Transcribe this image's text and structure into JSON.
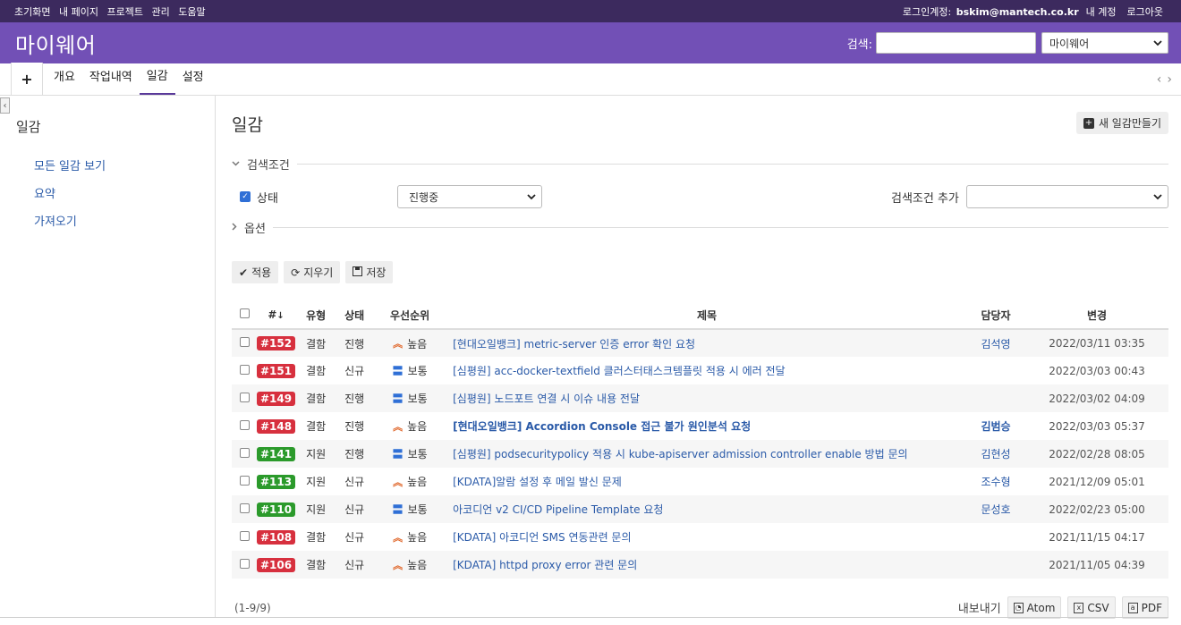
{
  "topbar": {
    "links": [
      "초기화면",
      "내 페이지",
      "프로젝트",
      "관리",
      "도움말"
    ],
    "login_label": "로그인계정:",
    "user": "bskim@mantech.co.kr",
    "my_account": "내 계정",
    "logout": "로그아웃"
  },
  "header": {
    "title": "마이웨어",
    "search_label": "검색:",
    "search_value": "",
    "project_select": "마이웨어"
  },
  "tabs": {
    "plus": "+",
    "items": [
      "개요",
      "작업내역",
      "일감",
      "설정"
    ],
    "active": "일감"
  },
  "sidebar": {
    "title": "일감",
    "links": [
      "모든 일감 보기",
      "요약",
      "가져오기"
    ]
  },
  "main": {
    "title": "일감",
    "new_button": "새 일감만들기",
    "filters_legend": "검색조건",
    "status_label": "상태",
    "status_value": "진행중",
    "add_filter_label": "검색조건 추가",
    "options_legend": "옵션",
    "apply": "적용",
    "clear": "지우기",
    "save": "저장"
  },
  "table": {
    "headers": {
      "id": "#",
      "tracker": "유형",
      "status": "상태",
      "priority": "우선순위",
      "subject": "제목",
      "assignee": "담당자",
      "updated": "변경"
    },
    "rows": [
      {
        "id": "#152",
        "kind": "bug",
        "tracker": "결함",
        "status": "진행",
        "priority": "높음",
        "pri": "hi",
        "subject": "[현대오일뱅크] metric-server 인증 error 확인 요청",
        "bold": false,
        "assignee": "김석영",
        "updated": "2022/03/11 03:35"
      },
      {
        "id": "#151",
        "kind": "bug",
        "tracker": "결함",
        "status": "신규",
        "priority": "보통",
        "pri": "no",
        "subject": "[심평원] acc-docker-textfield 클러스터태스크템플릿 적용 시 에러 전달",
        "bold": false,
        "assignee": "",
        "updated": "2022/03/03 00:43"
      },
      {
        "id": "#149",
        "kind": "bug",
        "tracker": "결함",
        "status": "진행",
        "priority": "보통",
        "pri": "no",
        "subject": "[심평원] 노드포트 연결 시 이슈 내용 전달",
        "bold": false,
        "assignee": "",
        "updated": "2022/03/02 04:09"
      },
      {
        "id": "#148",
        "kind": "bug",
        "tracker": "결함",
        "status": "진행",
        "priority": "높음",
        "pri": "hi",
        "subject": "[현대오일뱅크] Accordion Console 접근 불가 원인분석 요청",
        "bold": true,
        "assignee": "김범승",
        "updated": "2022/03/03 05:37"
      },
      {
        "id": "#141",
        "kind": "sup",
        "tracker": "지원",
        "status": "진행",
        "priority": "보통",
        "pri": "no",
        "subject": "[심평원] podsecuritypolicy 적용 시 kube-apiserver admission controller enable 방법 문의",
        "bold": false,
        "assignee": "김현성",
        "updated": "2022/02/28 08:05"
      },
      {
        "id": "#113",
        "kind": "sup",
        "tracker": "지원",
        "status": "신규",
        "priority": "높음",
        "pri": "hi",
        "subject": "[KDATA]알람 설정 후 메일 발신 문제",
        "bold": false,
        "assignee": "조수형",
        "updated": "2021/12/09 05:01"
      },
      {
        "id": "#110",
        "kind": "sup",
        "tracker": "지원",
        "status": "신규",
        "priority": "보통",
        "pri": "no",
        "subject": "아코디언 v2 CI/CD Pipeline Template 요청",
        "bold": false,
        "assignee": "문성호",
        "updated": "2022/02/23 05:00"
      },
      {
        "id": "#108",
        "kind": "bug",
        "tracker": "결함",
        "status": "신규",
        "priority": "높음",
        "pri": "hi",
        "subject": "[KDATA] 아코디언 SMS 연동관련 문의",
        "bold": false,
        "assignee": "",
        "updated": "2021/11/15 04:17"
      },
      {
        "id": "#106",
        "kind": "bug",
        "tracker": "결함",
        "status": "신규",
        "priority": "높음",
        "pri": "hi",
        "subject": "[KDATA] httpd proxy error 관련 문의",
        "bold": false,
        "assignee": "",
        "updated": "2021/11/05 04:39"
      }
    ]
  },
  "footer": {
    "count": "(1-9/9)",
    "export_label": "내보내기",
    "atom": "Atom",
    "csv": "CSV",
    "pdf": "PDF"
  }
}
